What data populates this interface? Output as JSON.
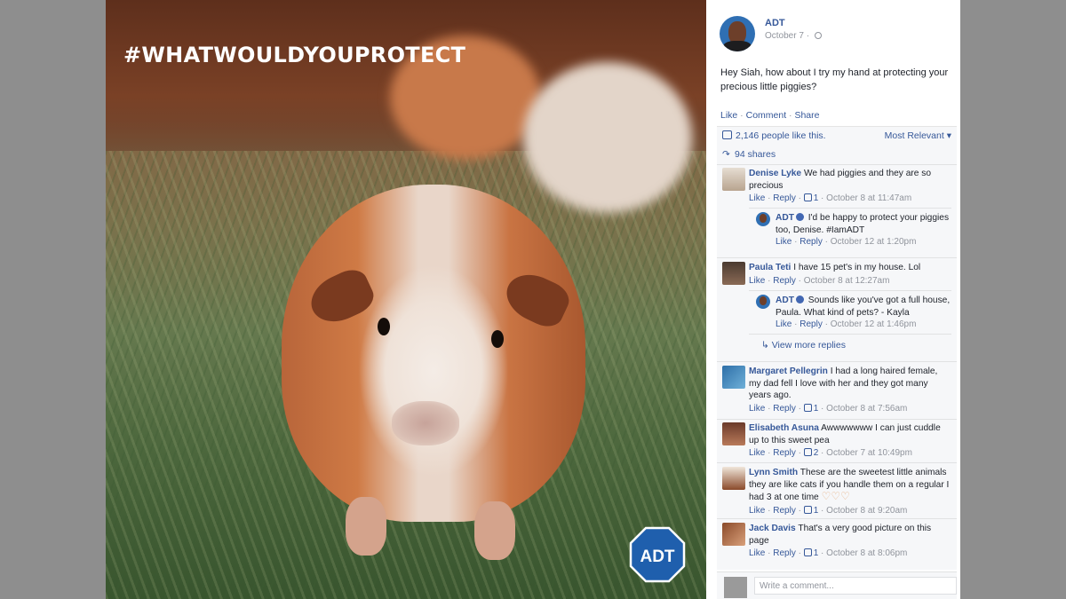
{
  "photo": {
    "hashtag": "#WHATWOULDYOUPROTECT",
    "logo_text": "ADT"
  },
  "post": {
    "author": "ADT",
    "date": "October 7",
    "separator": " · ",
    "text": "Hey Siah, how about I try my hand at protecting your precious little piggies?",
    "actions": {
      "like": "Like",
      "comment": "Comment",
      "share": "Share",
      "sep": " · "
    },
    "likes_text": "2,146 people like this.",
    "sort_label": "Most Relevant",
    "shares_text": "94 shares"
  },
  "comments": [
    {
      "author": "Denise Lyke",
      "text": "We had piggies and they are so precious",
      "like": "Like",
      "reply": "Reply",
      "reactions": "1",
      "time": "October 8 at 11:47am",
      "replies": [
        {
          "author": "ADT",
          "text": "I'd be happy to protect your piggies too, Denise. #IamADT",
          "like": "Like",
          "reply": "Reply",
          "time": "October 12 at 1:20pm"
        }
      ]
    },
    {
      "author": "Paula Teti",
      "text": "I have 15 pet's in my house. Lol",
      "like": "Like",
      "reply": "Reply",
      "time": "October 8 at 12:27am",
      "replies": [
        {
          "author": "ADT",
          "text": "Sounds like you've got a full house, Paula. What kind of pets? - Kayla",
          "like": "Like",
          "reply": "Reply",
          "time": "October 12 at 1:46pm"
        }
      ],
      "view_more": "View more replies"
    },
    {
      "author": "Margaret Pellegrin",
      "text": "I had a long haired female, my dad fell I love with her and they got many years ago.",
      "like": "Like",
      "reply": "Reply",
      "reactions": "1",
      "time": "October 8 at 7:56am"
    },
    {
      "author": "Elisabeth Asuna",
      "text": "Awwwwwww I can just cuddle up to this sweet pea",
      "like": "Like",
      "reply": "Reply",
      "reactions": "2",
      "time": "October 7 at 10:49pm"
    },
    {
      "author": "Lynn Smith",
      "text": "These are the sweetest little animals they are like cats if you handle them on a regular I had 3 at one time",
      "hearts": "♡♡♡",
      "like": "Like",
      "reply": "Reply",
      "reactions": "1",
      "time": "October 8 at 9:20am"
    },
    {
      "author": "Jack Davis",
      "text": "That's a very good picture on this page",
      "like": "Like",
      "reply": "Reply",
      "reactions": "1",
      "time": "October 8 at 8:06pm"
    }
  ],
  "write_comment": {
    "placeholder": "Write a comment..."
  },
  "colors": {
    "link": "#365899",
    "meta": "#90949c",
    "adt_blue": "#1f5fad"
  }
}
